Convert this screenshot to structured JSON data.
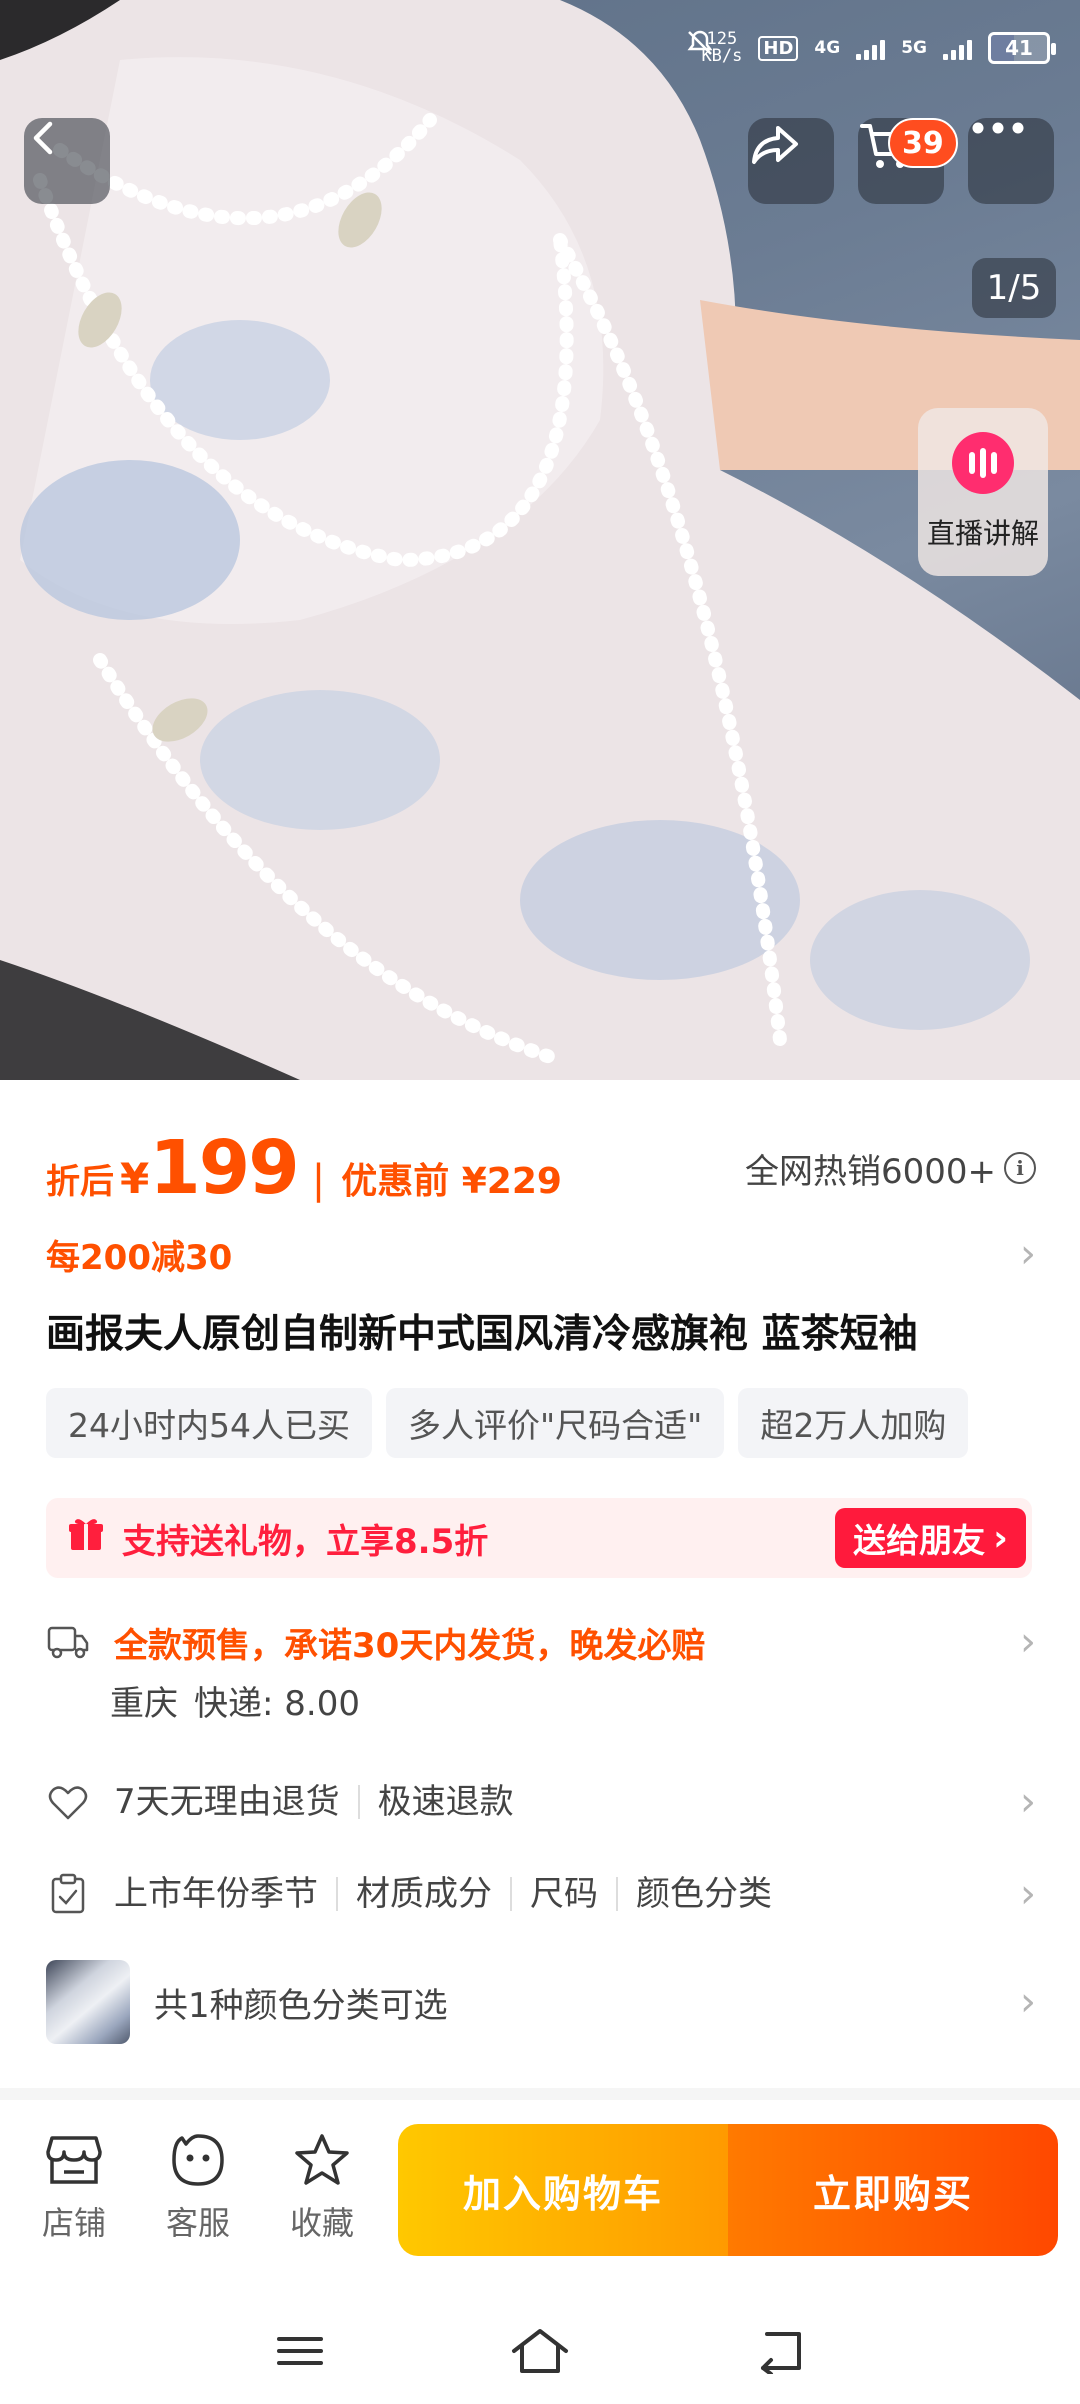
{
  "status_bar": {
    "net_speed_value": "125",
    "net_speed_unit": "KB/s",
    "hd_label": "HD",
    "net_4g": "4G",
    "net_5g": "5G",
    "battery": "41"
  },
  "hero": {
    "cart_badge": "39",
    "page_indicator": "1/5",
    "live_label": "直播讲解"
  },
  "price": {
    "prefix": "折后",
    "currency": "¥",
    "value": "199",
    "separator": "|",
    "before_label": "优惠前 ¥229",
    "hot_sales": "全网热销6000+"
  },
  "promo": {
    "text": "每200减30"
  },
  "product": {
    "title": "画报夫人原创自制新中式国风清冷感旗袍 蓝茶短袖"
  },
  "tags": [
    "24小时内54人已买",
    "多人评价\"尺码合适\"",
    "超2万人加购"
  ],
  "gift": {
    "text": "支持送礼物，立享8.5折",
    "button": "送给朋友"
  },
  "delivery": {
    "main": "全款预售，承诺30天内发货，晚发必赔",
    "city": "重庆",
    "fee": "快递: 8.00"
  },
  "service": {
    "items": [
      "7天无理由退货",
      "极速退款"
    ]
  },
  "params": {
    "items": [
      "上市年份季节",
      "材质成分",
      "尺码",
      "颜色分类"
    ]
  },
  "color_option": {
    "text": "共1种颜色分类可选"
  },
  "bottom_bar": {
    "store": "店铺",
    "service": "客服",
    "favorite": "收藏",
    "add_to_cart": "加入购物车",
    "buy_now": "立即购买"
  },
  "colors": {
    "accent_orange": "#ff5000",
    "gift_red": "#ff1a3c",
    "live_pink": "#ff2d6f"
  },
  "icons": {
    "back": "chevron-left-icon",
    "share": "share-icon",
    "cart": "cart-icon",
    "more": "more-dots-icon",
    "live": "live-bars-icon",
    "gift": "gift-icon",
    "truck": "truck-icon",
    "heart": "heart-icon",
    "clipboard": "clipboard-icon",
    "store": "store-icon",
    "service": "service-face-icon",
    "favorite": "star-icon",
    "nav_menu": "menu-icon",
    "nav_home": "home-icon",
    "nav_back": "back-icon"
  }
}
